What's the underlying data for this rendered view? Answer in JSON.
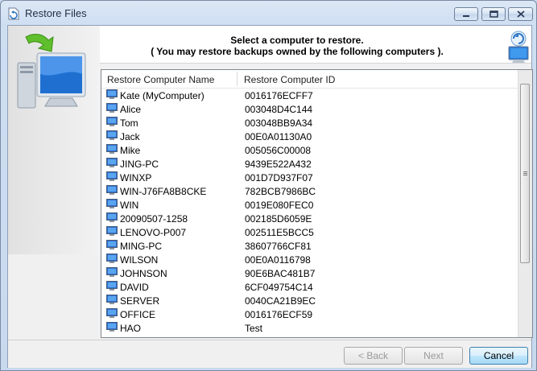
{
  "window": {
    "title": "Restore Files"
  },
  "header": {
    "line1": "Select a computer to restore.",
    "line2": "( You may restore backups owned by the following computers )."
  },
  "table": {
    "columns": [
      "Restore Computer Name",
      "Restore Computer ID"
    ],
    "rows": [
      {
        "name": "Kate (MyComputer)",
        "id": "0016176ECFF7"
      },
      {
        "name": "Alice",
        "id": "003048D4C144"
      },
      {
        "name": "Tom",
        "id": "003048BB9A34"
      },
      {
        "name": "Jack",
        "id": "00E0A01130A0"
      },
      {
        "name": "Mike",
        "id": "005056C00008"
      },
      {
        "name": "JING-PC",
        "id": "9439E522A432"
      },
      {
        "name": "WINXP",
        "id": "001D7D937F07"
      },
      {
        "name": "WIN-J76FA8B8CKE",
        "id": "782BCB7986BC"
      },
      {
        "name": "WIN",
        "id": "0019E080FEC0"
      },
      {
        "name": "20090507-1258",
        "id": "002185D6059E"
      },
      {
        "name": "LENOVO-P007",
        "id": "002511E5BCC5"
      },
      {
        "name": "MING-PC",
        "id": "38607766CF81"
      },
      {
        "name": "WILSON",
        "id": "00E0A0116798"
      },
      {
        "name": "JOHNSON",
        "id": "90E6BAC481B7"
      },
      {
        "name": "DAVID",
        "id": "6CF049754C14"
      },
      {
        "name": "SERVER",
        "id": "0040CA21B9EC"
      },
      {
        "name": "OFFICE",
        "id": "0016176ECF59"
      },
      {
        "name": "HAO",
        "id": "Test"
      }
    ]
  },
  "buttons": {
    "back": "< Back",
    "next": "Next",
    "cancel": "Cancel"
  },
  "icons": {
    "app": "restore-app-icon",
    "monitor": "computer-monitor-icon",
    "row": "computer-icon",
    "restore": "restore-computer-icon"
  }
}
